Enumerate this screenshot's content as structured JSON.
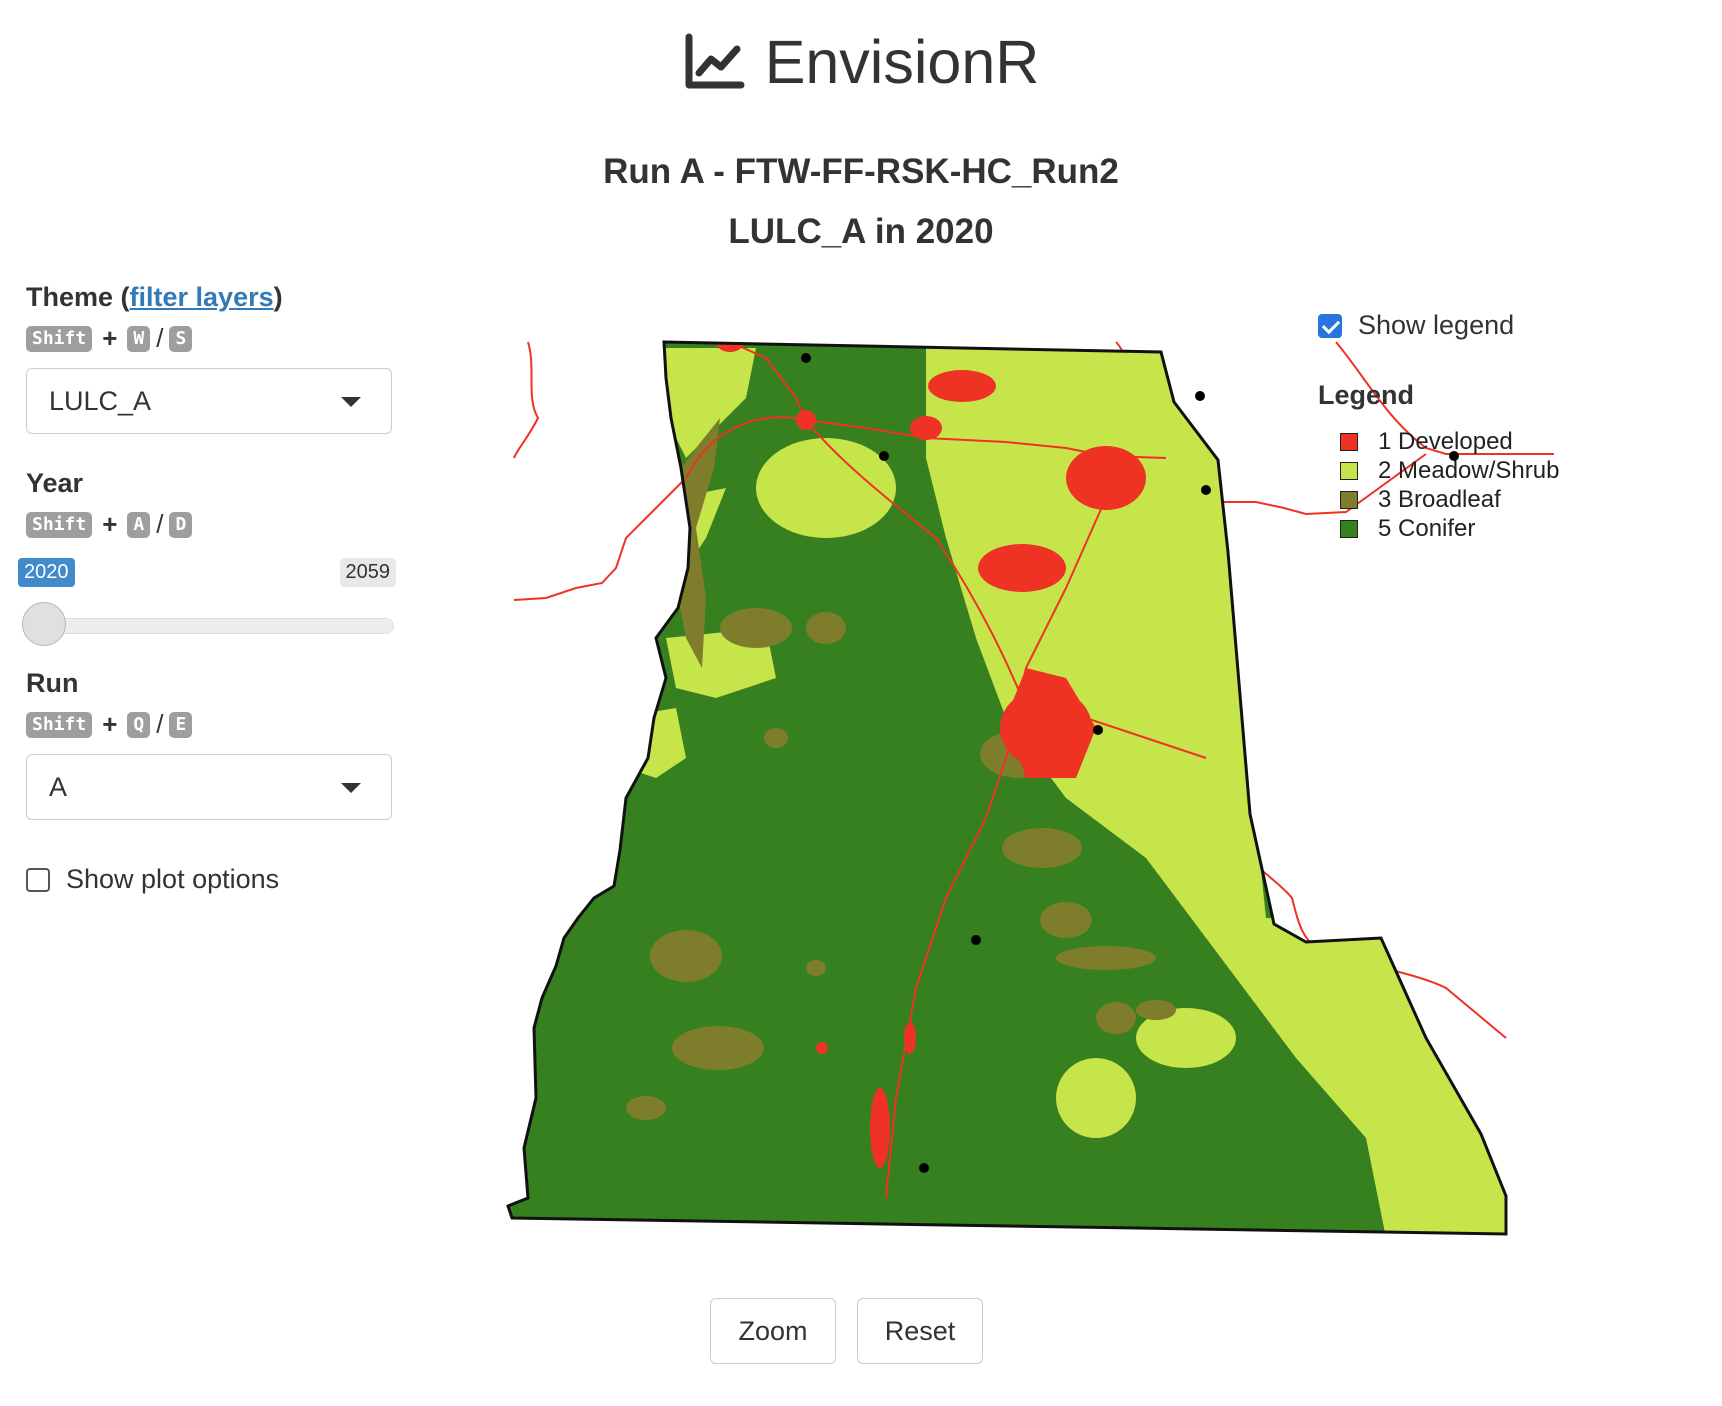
{
  "app": {
    "title": "EnvisionR"
  },
  "sidebar": {
    "theme": {
      "label": "Theme",
      "paren_open": " (",
      "filter_link": "filter layers",
      "paren_close": ")",
      "shortcut": {
        "modifier": "Shift",
        "plus": "+",
        "key_prev": "W",
        "sep": "/",
        "key_next": "S"
      },
      "selected": "LULC_A"
    },
    "year": {
      "label": "Year",
      "shortcut": {
        "modifier": "Shift",
        "plus": "+",
        "key_prev": "A",
        "sep": "/",
        "key_next": "D"
      },
      "min": "2020",
      "max": "2059",
      "value": 2020
    },
    "run": {
      "label": "Run",
      "shortcut": {
        "modifier": "Shift",
        "plus": "+",
        "key_prev": "Q",
        "sep": "/",
        "key_next": "E"
      },
      "selected": "A"
    },
    "plot_options": {
      "label": "Show plot options",
      "checked": false
    }
  },
  "plot": {
    "title": "Run A - FTW-FF-RSK-HC_Run2",
    "subtitle": "LULC_A in 2020",
    "show_legend": {
      "label": "Show legend",
      "checked": true
    },
    "legend": {
      "title": "Legend",
      "items": [
        {
          "label": "1 Developed",
          "color": "#ee3224"
        },
        {
          "label": "2 Meadow/Shrub",
          "color": "#c6e54a"
        },
        {
          "label": "3 Broadleaf",
          "color": "#7e7d2b"
        },
        {
          "label": "5 Conifer",
          "color": "#36801f"
        }
      ]
    }
  },
  "buttons": {
    "zoom": "Zoom",
    "reset": "Reset"
  }
}
